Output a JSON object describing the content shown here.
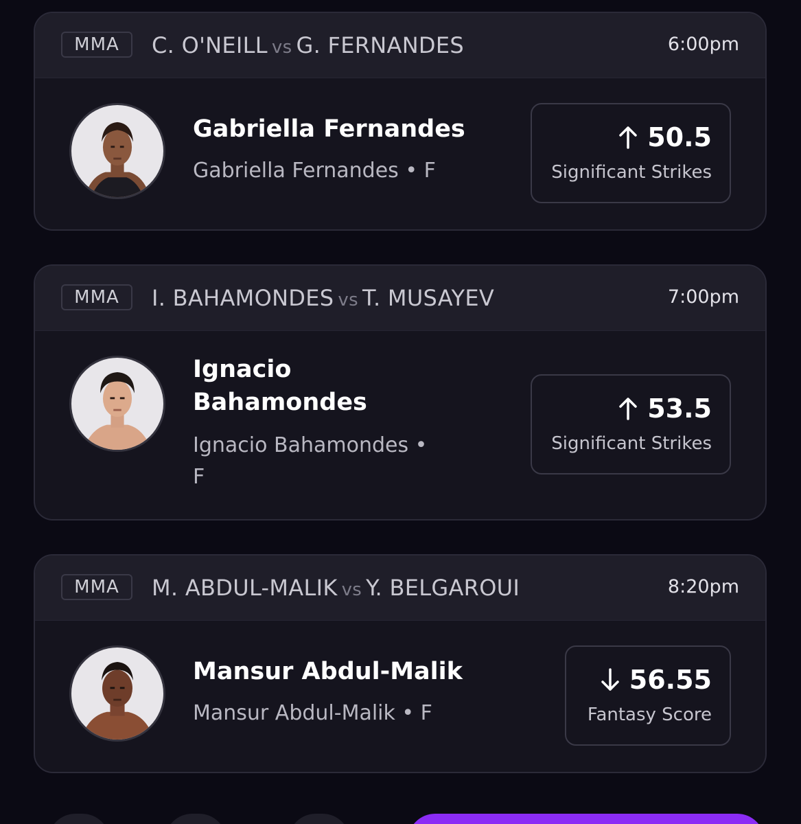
{
  "cards": [
    {
      "sport": "MMA",
      "team_a": "C. O'NEILL",
      "vs": "vs",
      "team_b": "G. FERNANDES",
      "time": "6:00pm",
      "player_name": "Gabriella Fernandes",
      "player_sub": "Gabriella Fernandes • F",
      "line_value": "50.5",
      "line_label": "Significant Strikes",
      "direction_icon": "arrow-up-icon"
    },
    {
      "sport": "MMA",
      "team_a": "I. BAHAMONDES",
      "vs": "vs",
      "team_b": "T. MUSAYEV",
      "time": "7:00pm",
      "player_name_line1": "Ignacio",
      "player_name_line2": "Bahamondes",
      "player_sub_line1": "Ignacio Bahamondes •",
      "player_sub_line2": "F",
      "line_value": "53.5",
      "line_label": "Significant Strikes",
      "direction_icon": "arrow-up-icon"
    },
    {
      "sport": "MMA",
      "team_a": "M. ABDUL-MALIK",
      "vs": "vs",
      "team_b": "Y. BELGAROUI",
      "time": "8:20pm",
      "player_name": "Mansur Abdul-Malik",
      "player_sub": "Mansur Abdul-Malik • F",
      "line_value": "56.55",
      "line_label": "Fantasy Score",
      "direction_icon": "arrow-down-icon"
    }
  ],
  "colors": {
    "background": "#0b0a14",
    "card": "#15141e",
    "header": "#1f1e29",
    "accent": "#8b2cf5"
  }
}
